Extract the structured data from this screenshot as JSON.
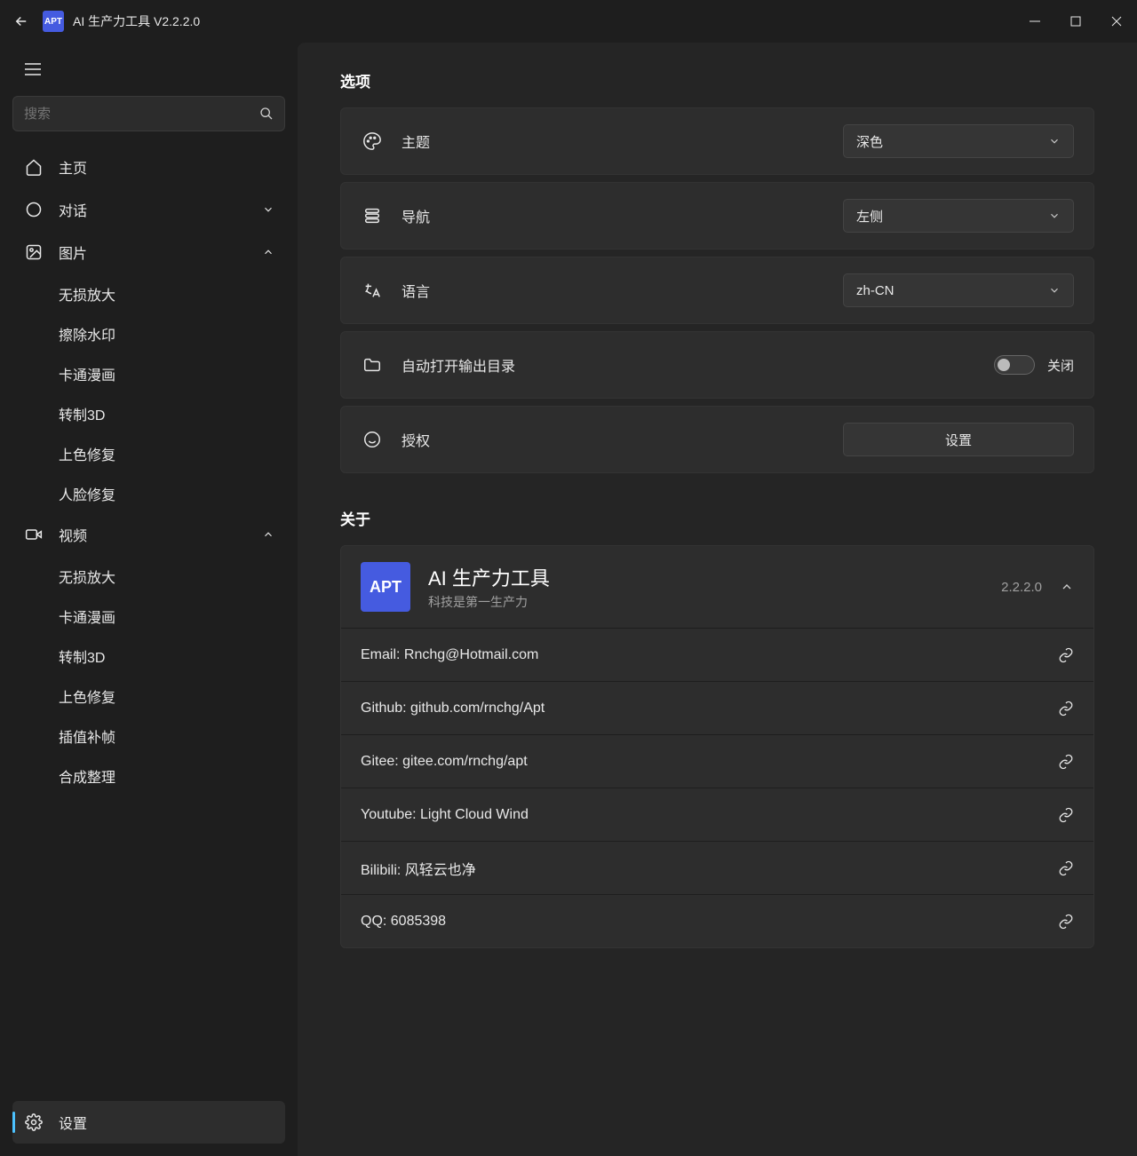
{
  "titlebar": {
    "title": "AI 生产力工具 V2.2.2.0",
    "logo_text": "APT"
  },
  "sidebar": {
    "search_placeholder": "搜索",
    "home": "主页",
    "chat": "对话",
    "image": "图片",
    "image_items": [
      "无损放大",
      "擦除水印",
      "卡通漫画",
      "转制3D",
      "上色修复",
      "人脸修复"
    ],
    "video": "视频",
    "video_items": [
      "无损放大",
      "卡通漫画",
      "转制3D",
      "上色修复",
      "插值补帧",
      "合成整理"
    ],
    "settings": "设置"
  },
  "options": {
    "section": "选项",
    "theme": {
      "label": "主题",
      "value": "深色"
    },
    "nav": {
      "label": "导航",
      "value": "左侧"
    },
    "lang": {
      "label": "语言",
      "value": "zh-CN"
    },
    "autoopen": {
      "label": "自动打开输出目录",
      "state": "关闭"
    },
    "auth": {
      "label": "授权",
      "button": "设置"
    }
  },
  "about": {
    "section": "关于",
    "logo_text": "APT",
    "name": "AI 生产力工具",
    "slogan": "科技是第一生产力",
    "version": "2.2.2.0",
    "links": [
      "Email: Rnchg@Hotmail.com",
      "Github: github.com/rnchg/Apt",
      "Gitee: gitee.com/rnchg/apt",
      "Youtube: Light Cloud Wind",
      "Bilibili: 风轻云也净",
      "QQ: 6085398"
    ]
  }
}
